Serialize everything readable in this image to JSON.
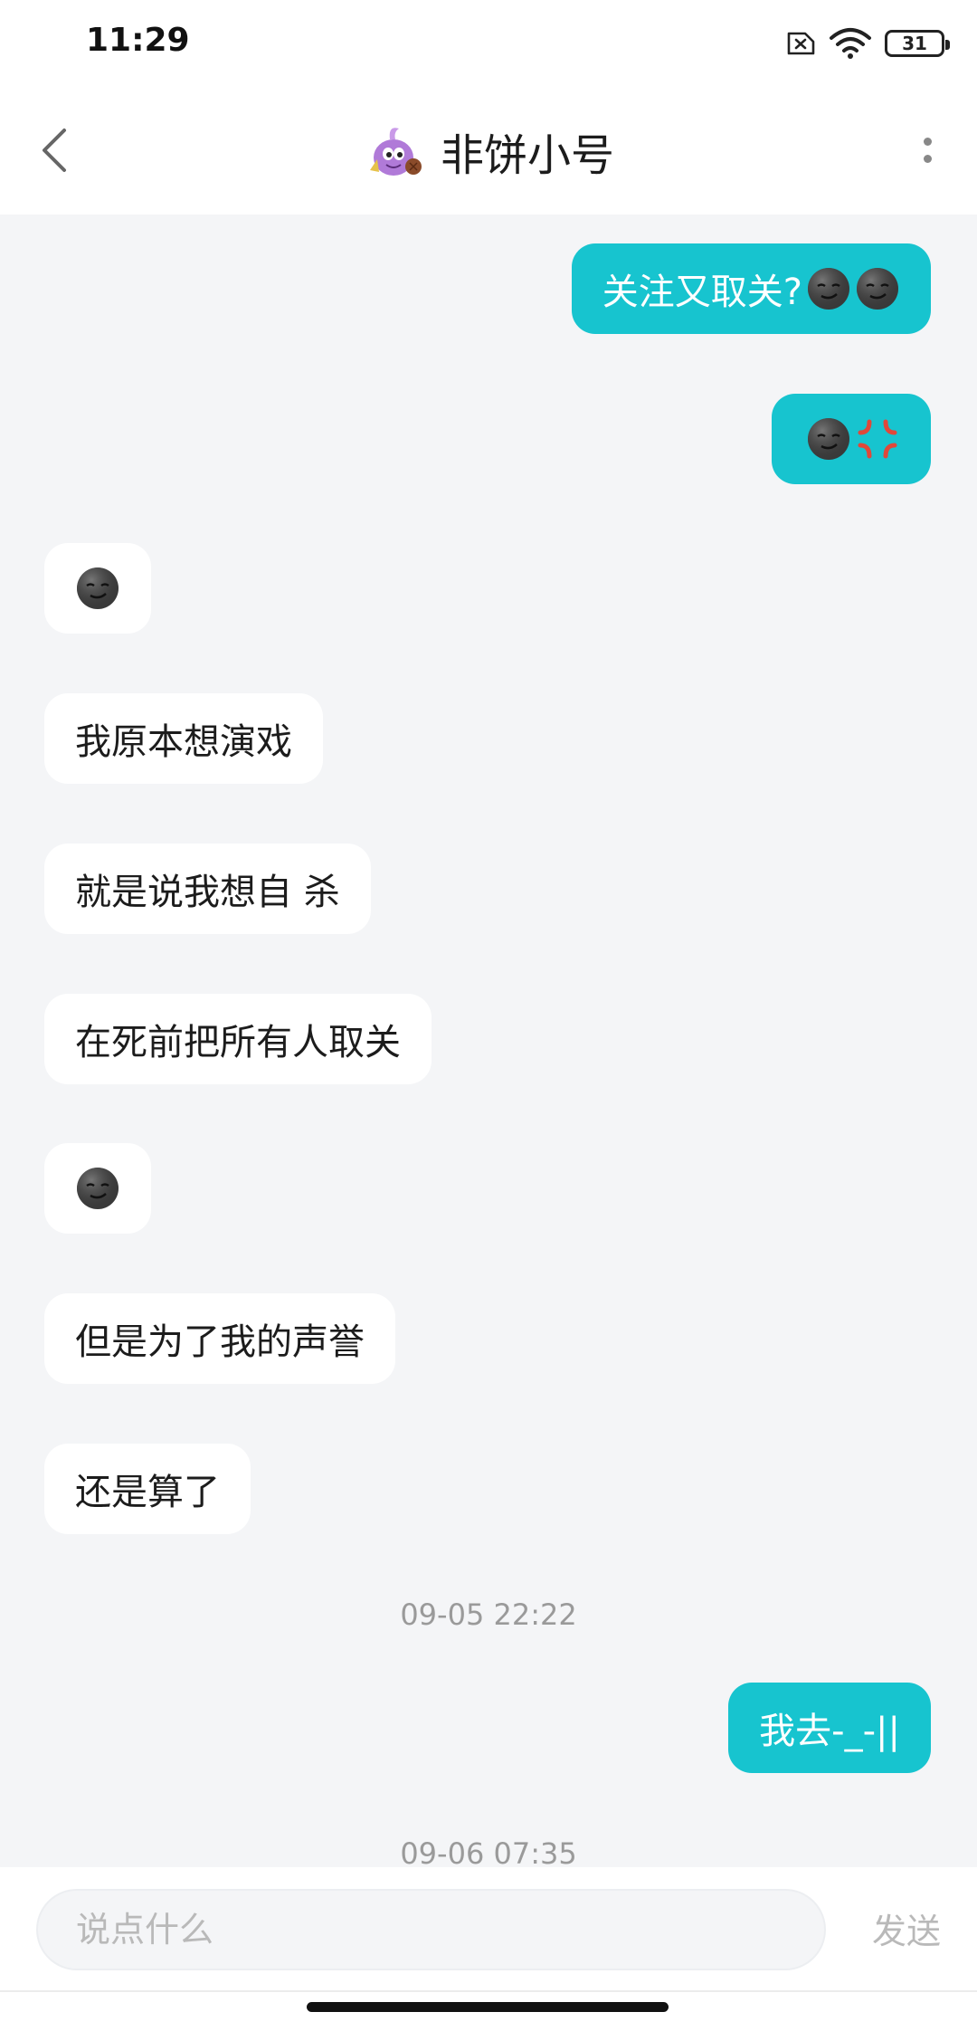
{
  "status_bar": {
    "time": "11:29",
    "battery": "31",
    "icons": [
      "sim-error-icon",
      "wifi-icon",
      "battery-icon"
    ]
  },
  "header": {
    "title": "非饼小号",
    "back_icon": "chevron-left-icon",
    "more_icon": "more-vertical-icon",
    "avatar": "purple-cartoon-avatar"
  },
  "messages": [
    {
      "side": "out",
      "text": "关注又取关?",
      "emojis": [
        "moon-face",
        "moon-face"
      ]
    },
    {
      "side": "out",
      "text": "",
      "emojis": [
        "moon-face",
        "anger-symbol"
      ]
    },
    {
      "side": "in",
      "text": "",
      "emojis": [
        "moon-face"
      ]
    },
    {
      "side": "in",
      "text": "我原本想演戏",
      "emojis": []
    },
    {
      "side": "in",
      "text": "就是说我想自 杀",
      "emojis": []
    },
    {
      "side": "in",
      "text": "在死前把所有人取关",
      "emojis": []
    },
    {
      "side": "in",
      "text": "",
      "emojis": [
        "moon-face"
      ]
    },
    {
      "side": "in",
      "text": "但是为了我的声誉",
      "emojis": []
    },
    {
      "side": "in",
      "text": "还是算了",
      "emojis": []
    },
    {
      "side": "time",
      "text": "09-05 22:22"
    },
    {
      "side": "out",
      "text": "我去-_-||",
      "emojis": []
    },
    {
      "side": "time",
      "text": "09-06 07:35"
    }
  ],
  "input": {
    "placeholder": "说点什么",
    "value": "",
    "send_label": "发送"
  },
  "colors": {
    "outgoing_bubble": "#17c4cf",
    "incoming_bubble": "#ffffff",
    "chat_background": "#f4f5f7"
  }
}
